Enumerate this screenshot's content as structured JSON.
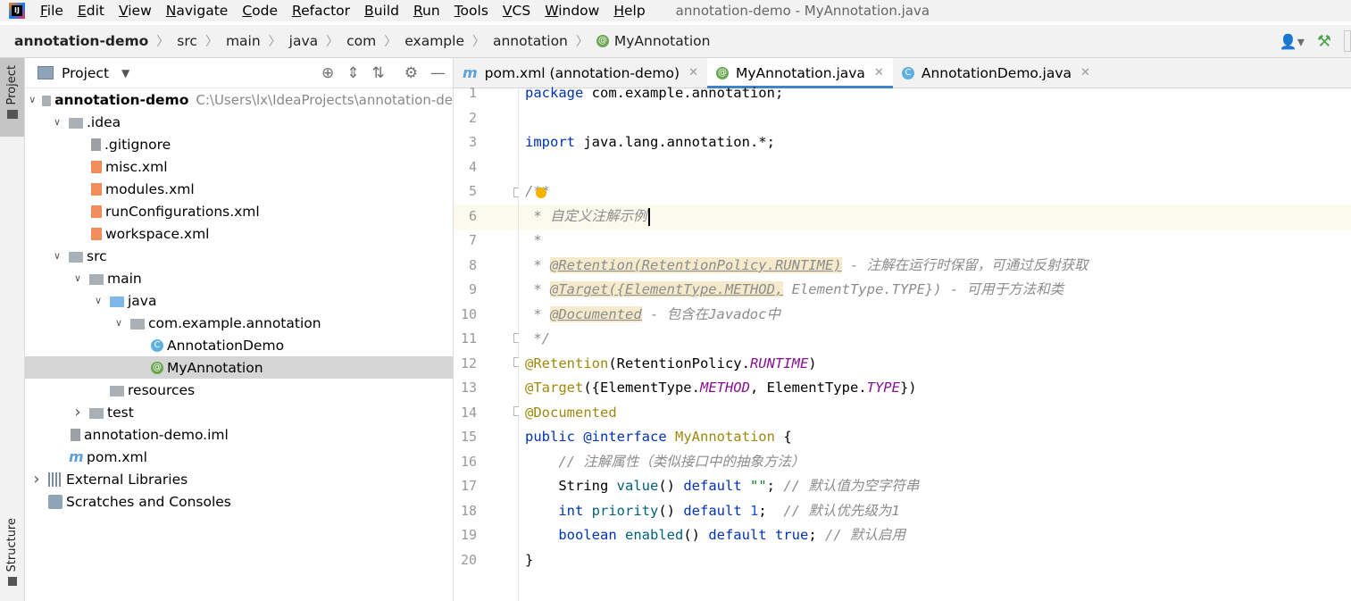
{
  "menubar": {
    "app_icon": "intellij-icon",
    "items": [
      {
        "label": "File",
        "mnemonic": "F",
        "rest": "ile"
      },
      {
        "label": "Edit",
        "mnemonic": "E",
        "rest": "dit"
      },
      {
        "label": "View",
        "mnemonic": "V",
        "rest": "iew"
      },
      {
        "label": "Navigate",
        "mnemonic": "N",
        "rest": "avigate"
      },
      {
        "label": "Code",
        "mnemonic": "C",
        "rest": "ode"
      },
      {
        "label": "Refactor",
        "mnemonic": "R",
        "rest": "efactor"
      },
      {
        "label": "Build",
        "mnemonic": "B",
        "rest": "uild"
      },
      {
        "label": "Run",
        "mnemonic": "R",
        "rest": "un"
      },
      {
        "label": "Tools",
        "mnemonic": "T",
        "rest": "ools"
      },
      {
        "label": "VCS",
        "mnemonic": "V",
        "rest": "CS"
      },
      {
        "label": "Window",
        "mnemonic": "W",
        "rest": "indow"
      },
      {
        "label": "Help",
        "mnemonic": "H",
        "rest": "elp"
      }
    ],
    "window_title": "annotation-demo - MyAnnotation.java"
  },
  "breadcrumb": {
    "items": [
      "annotation-demo",
      "src",
      "main",
      "java",
      "com",
      "example",
      "annotation",
      "MyAnnotation"
    ],
    "separator": "〉"
  },
  "left_strip": {
    "project_label": "Project",
    "structure_label": "Structure"
  },
  "project_panel": {
    "title": "Project",
    "tools": [
      "locate-icon",
      "expand-all-icon",
      "collapse-all-icon",
      "settings-icon",
      "hide-icon"
    ],
    "root_path": "C:\\Users\\lx\\IdeaProjects\\annotation-de",
    "tree": [
      {
        "label": "annotation-demo",
        "indent": 0,
        "arrow": "open",
        "icon": "module-folder-icon",
        "bold": true
      },
      {
        "label": ".idea",
        "indent": 1,
        "arrow": "open",
        "icon": "folder-icon"
      },
      {
        "label": ".gitignore",
        "indent": 2,
        "arrow": "",
        "icon": "file-icon"
      },
      {
        "label": "misc.xml",
        "indent": 2,
        "arrow": "",
        "icon": "xml-icon"
      },
      {
        "label": "modules.xml",
        "indent": 2,
        "arrow": "",
        "icon": "xml-icon"
      },
      {
        "label": "runConfigurations.xml",
        "indent": 2,
        "arrow": "",
        "icon": "xml-icon"
      },
      {
        "label": "workspace.xml",
        "indent": 2,
        "arrow": "",
        "icon": "xml-icon"
      },
      {
        "label": "src",
        "indent": 1,
        "arrow": "open",
        "icon": "folder-icon"
      },
      {
        "label": "main",
        "indent": 2,
        "arrow": "open",
        "icon": "folder-icon"
      },
      {
        "label": "java",
        "indent": 3,
        "arrow": "open",
        "icon": "source-folder-icon"
      },
      {
        "label": "com.example.annotation",
        "indent": 4,
        "arrow": "open",
        "icon": "package-icon"
      },
      {
        "label": "AnnotationDemo",
        "indent": 5,
        "arrow": "",
        "icon": "class-icon"
      },
      {
        "label": "MyAnnotation",
        "indent": 5,
        "arrow": "",
        "icon": "annotation-icon",
        "selected": true
      },
      {
        "label": "resources",
        "indent": 3,
        "arrow": "",
        "icon": "resources-folder-icon"
      },
      {
        "label": "test",
        "indent": 2,
        "arrow": "closed",
        "icon": "folder-icon"
      },
      {
        "label": "annotation-demo.iml",
        "indent": 1,
        "arrow": "",
        "icon": "iml-file-icon"
      },
      {
        "label": "pom.xml",
        "indent": 1,
        "arrow": "",
        "icon": "maven-icon"
      },
      {
        "label": "External Libraries",
        "indent": 0,
        "arrow": "closed",
        "icon": "libraries-icon"
      },
      {
        "label": "Scratches and Consoles",
        "indent": 0,
        "arrow": "",
        "icon": "scratches-icon"
      }
    ]
  },
  "editor_tabs": [
    {
      "label": "pom.xml (annotation-demo)",
      "icon": "maven-icon",
      "glyph": "m",
      "active": false
    },
    {
      "label": "MyAnnotation.java",
      "icon": "annotation-icon",
      "glyph": "@",
      "active": true
    },
    {
      "label": "AnnotationDemo.java",
      "icon": "class-icon",
      "glyph": "C",
      "active": false
    }
  ],
  "editor": {
    "line_numbers": [
      "1",
      "2",
      "3",
      "4",
      "5",
      "6",
      "7",
      "8",
      "9",
      "10",
      "11",
      "12",
      "13",
      "14",
      "15",
      "16",
      "17",
      "18",
      "19",
      "20"
    ],
    "code": {
      "l1_kw": "package",
      "l1_rest": " com.example.annotation;",
      "l3_kw": "import",
      "l3_rest": " java.lang.annotation.*;",
      "l5": "/**",
      "l6_star": " * ",
      "l6_text": "自定义注解示例",
      "l7": " *",
      "l8_star": " * ",
      "l8_tag": "@Retention(RetentionPolicy.RUNTIME)",
      "l8_text": " - 注解在运行时保留，可通过反射获取",
      "l9_star": " * ",
      "l9_tag": "@Target({ElementType.METHOD,",
      "l9_text": " ElementType.TYPE}) - 可用于方法和类",
      "l10_star": " * ",
      "l10_tag": "@Documented",
      "l10_text": " - 包含在Javadoc中",
      "l11": " */",
      "l12_ann": "@Retention",
      "l12_a": "(RetentionPolicy.",
      "l12_const": "RUNTIME",
      "l12_b": ")",
      "l13_ann": "@Target",
      "l13_a": "({ElementType.",
      "l13_const1": "METHOD",
      "l13_b": ", ElementType.",
      "l13_const2": "TYPE",
      "l13_c": "})",
      "l14_ann": "@Documented",
      "l15_kw": "public",
      "l15_kw2": " @interface",
      "l15_name": " MyAnnotation",
      "l15_rest": " {",
      "l16_cmt": "    // 注解属性（类似接口中的抽象方法）",
      "l17_type": "    String ",
      "l17_meth": "value",
      "l17_a": "() ",
      "l17_kw": "default",
      "l17_str": " \"\"",
      "l17_b": "; ",
      "l17_cmt": "// 默认值为空字符串",
      "l18_type": "    int",
      "l18_meth": " priority",
      "l18_a": "() ",
      "l18_kw": "default",
      "l18_num": " 1",
      "l18_b": ";  ",
      "l18_cmt": "// 默认优先级为1",
      "l19_type": "    boolean",
      "l19_meth": " enabled",
      "l19_a": "() ",
      "l19_kw": "default",
      "l19_kw2": " true",
      "l19_b": "; ",
      "l19_cmt": "// 默认启用",
      "l20": "}"
    }
  }
}
